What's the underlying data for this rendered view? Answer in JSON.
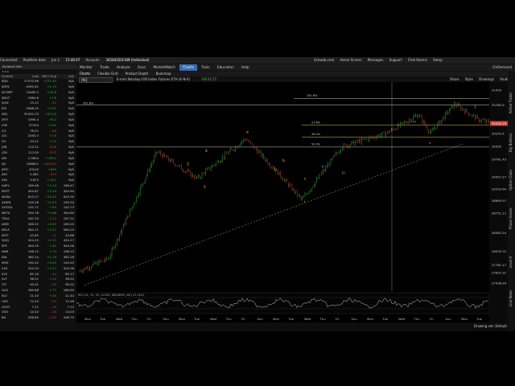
{
  "topbar": {
    "connected": "Connected",
    "realtime": "Realtime data",
    "date": "Jun 1",
    "time": "15:40:47",
    "account_label": "Account:",
    "account": "3458435SCHW (Individual)",
    "links": [
      "Schwab.com",
      "Home Screen",
      "Messages",
      "Support",
      "Chat Rooms",
      "Setup"
    ],
    "ondemand": "OnDemand"
  },
  "nav": [
    "Monitor",
    "Trade",
    "Analyze",
    "Scan",
    "MarketWatch",
    "Charts",
    "Tools",
    "Education",
    "Help"
  ],
  "nav_active": "Charts",
  "chart_tabs": [
    "Charts",
    "Flexible Grid",
    "Product Depth",
    "Bookmap"
  ],
  "chart_toolbar": {
    "symbol": "/NQ",
    "description": "E-mini Nasdaq-100 Index Futures ETH (E-N-0)",
    "price": "30432.25",
    "tools": [
      "Share",
      "Style",
      "Drawings",
      "Studies"
    ]
  },
  "watchlist": {
    "title": "Account Info",
    "columns": [
      "Symbol",
      "Last",
      "Net Chng",
      "Ask"
    ],
    "rows": [
      [
        "$DJI",
        "37070.96",
        "+131.40",
        "N/A"
      ],
      [
        "$SPX",
        "4950.61",
        "+1.73",
        "N/A"
      ],
      [
        "$COMP",
        "15480.3",
        "+29.8",
        "N/A"
      ],
      [
        "$RUT",
        "1984.6",
        "+7.8",
        "N/A"
      ],
      [
        "$VIX",
        "13.12",
        "-.41",
        "N/A"
      ],
      [
        "/ES",
        "4966.25",
        "+3.50",
        "N/A"
      ],
      [
        "/NQ",
        "30432.25",
        "+53.25",
        "N/A"
      ],
      [
        "/RTY",
        "1990.4",
        "+8.2",
        "N/A"
      ],
      [
        "/YM",
        "37194",
        "+112",
        "N/A"
      ],
      [
        "/CL",
        "78.01",
        "-.68",
        "N/A"
      ],
      [
        "/GC",
        "2055.3",
        "+7.9",
        "N/A"
      ],
      [
        "/SI",
        "23.21",
        "+.12",
        "N/A"
      ],
      [
        "/ZB",
        "122'12",
        "-0'08",
        "N/A"
      ],
      [
        "/ZN",
        "111'05",
        "-0'03",
        "N/A"
      ],
      [
        "/6E",
        "1.0834",
        "+.0011",
        "N/A"
      ],
      [
        "/6J",
        ".006812",
        "-.000010",
        "N/A"
      ],
      [
        "/BTC",
        "43120",
        "+620",
        "N/A"
      ],
      [
        "/NG",
        "2.081",
        "-.034",
        "N/A"
      ],
      [
        "/HG",
        "3.872",
        "+.021",
        "N/A"
      ],
      [
        "AAPL",
        "189.46",
        "+1.24",
        "189.47"
      ],
      [
        "MSFT",
        "404.87",
        "+3.19",
        "404.90"
      ],
      [
        "NVDA",
        "615.27",
        "+12.42",
        "615.30"
      ],
      [
        "AMZN",
        "159.28",
        "+2.03",
        "159.30"
      ],
      [
        "GOOGL",
        "142.71",
        "+.84",
        "142.73"
      ],
      [
        "META",
        "394.78",
        "+5.66",
        "394.80"
      ],
      [
        "TSLA",
        "187.29",
        "-3.14",
        "187.31"
      ],
      [
        "AMD",
        "169.22",
        "+4.01",
        "169.25"
      ],
      [
        "NFLX",
        "564.11",
        "+2.37",
        "564.20"
      ],
      [
        "INTC",
        "43.65",
        "-.12",
        "43.66"
      ],
      [
        "QQQ",
        "424.25",
        "+2.11",
        "424.27"
      ],
      [
        "SPY",
        "494.35",
        "+.81",
        "494.36"
      ],
      [
        "IWM",
        "198.12",
        "+.74",
        "198.13"
      ],
      [
        "DIA",
        "382.24",
        "+1.19",
        "382.26"
      ],
      [
        "SMH",
        "190.42",
        "+3.05",
        "190.45"
      ],
      [
        "XLK",
        "204.34",
        "+1.27",
        "204.36"
      ],
      [
        "XLE",
        "85.16",
        "-.44",
        "85.17"
      ],
      [
        "XLF",
        "38.51",
        "+.22",
        "38.52"
      ],
      [
        "TLT",
        "95.01",
        "-.30",
        "95.02"
      ],
      [
        "GLD",
        "189.88",
        "+.77",
        "189.90"
      ],
      [
        "SLV",
        "21.43",
        "+.10",
        "21.44"
      ],
      [
        "USO",
        "72.45",
        "-.63",
        "72.46"
      ],
      [
        "UVXY",
        "7.21",
        "-.19",
        "7.22"
      ],
      [
        "VXX",
        "14.02",
        "-.28",
        "14.03"
      ],
      [
        "BA",
        "208.65",
        "-1.02",
        "208.70"
      ]
    ]
  },
  "price_axis": [
    "31059",
    "30780.9",
    "30432.25",
    "30243.4",
    "30000",
    "29761.43",
    "29427.27",
    "29202.64",
    "28985.97",
    "28751.11",
    "28382.54",
    "28035.32",
    "27781.17",
    "27631.91",
    "27438.94"
  ],
  "time_axis": [
    "Mon",
    "Tue",
    "Wed",
    "Thu",
    "Fri",
    "Sun",
    "Mon",
    "Tue",
    "Wed",
    "Thu",
    "Fri",
    "Sun",
    "Mon",
    "Tue",
    "Wed",
    "Thu",
    "Fri",
    "Sun",
    "Mon",
    "Tue",
    "Wed",
    "Thu",
    "Fri",
    "Sun",
    "Mon",
    "Tue"
  ],
  "fib_labels": [
    "261.8%",
    "161.8%",
    "23.6%",
    "38.2%",
    "50.0%"
  ],
  "wave_labels": [
    "1",
    "2",
    "3",
    "4",
    "5",
    "a",
    "b",
    "c",
    "i",
    "ii",
    "iii",
    "iv",
    "v"
  ],
  "study_label": "RSI (14, 70, 30, CLOSE, WILDERS, NO) 47.0247",
  "status": "Drawing set: Default",
  "vertical_tabs": [
    "Active Trader",
    "Big Buttons",
    "Option Chain",
    "Phase Scores",
    "Level II",
    "Live News"
  ],
  "colors": {
    "up": "#2fbf2f",
    "down": "#d04040",
    "accent": "#3a6bb0",
    "fib": "#e6c84a"
  }
}
